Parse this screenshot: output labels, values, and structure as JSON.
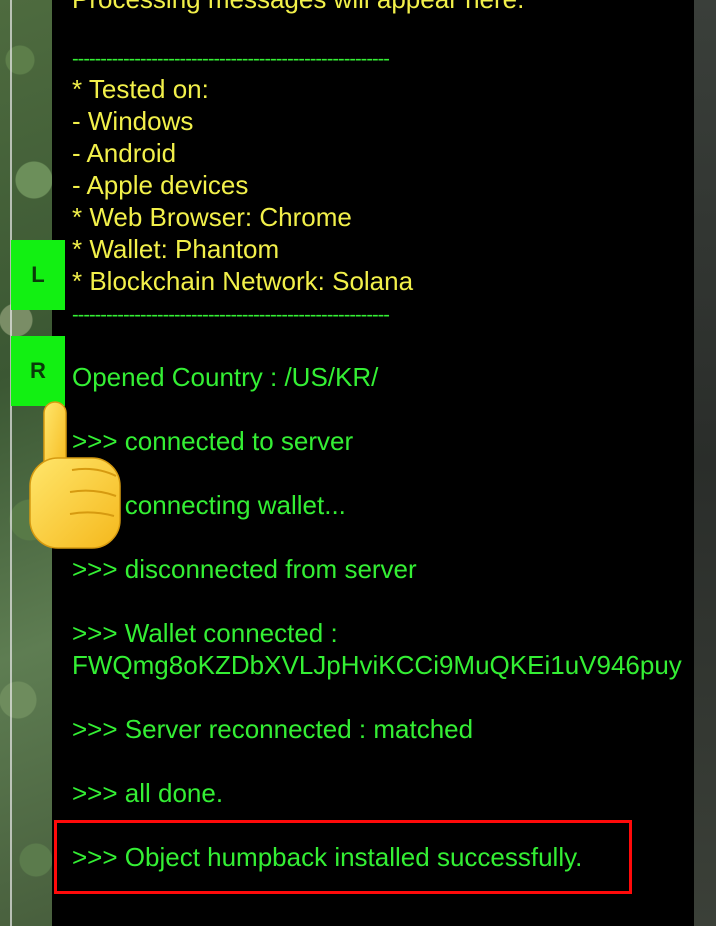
{
  "console": {
    "partial_top": "Processing messages will appear here.",
    "separator": "--------------------------------------------------------",
    "tested_on": "* Tested on:",
    "platforms": [
      " - Windows",
      " - Android",
      " - Apple devices"
    ],
    "browser": "* Web Browser: Chrome",
    "wallet": "* Wallet: Phantom",
    "network": "* Blockchain Network: Solana",
    "log": [
      "Opened Country : /US/KR/",
      ">>> connected to server",
      ">>> connecting wallet...",
      ">>> disconnected from server",
      ">>> Wallet connected :",
      "FWQmg8oKZDbXVLJpHviKCCi9MuQKEi1uV946puy",
      ">>> Server reconnected : matched",
      ">>> all done.",
      ">>> Object humpback installed successfully."
    ]
  },
  "buttons": {
    "left": "L",
    "right": "R"
  },
  "colors": {
    "console_bg": "#000000",
    "info_text": "#f2f04a",
    "log_text": "#34ef34",
    "button_bg": "#12f012",
    "highlight": "#ff0a0a"
  },
  "icons": {
    "pointer": "pointing-hand-emoji-icon"
  }
}
